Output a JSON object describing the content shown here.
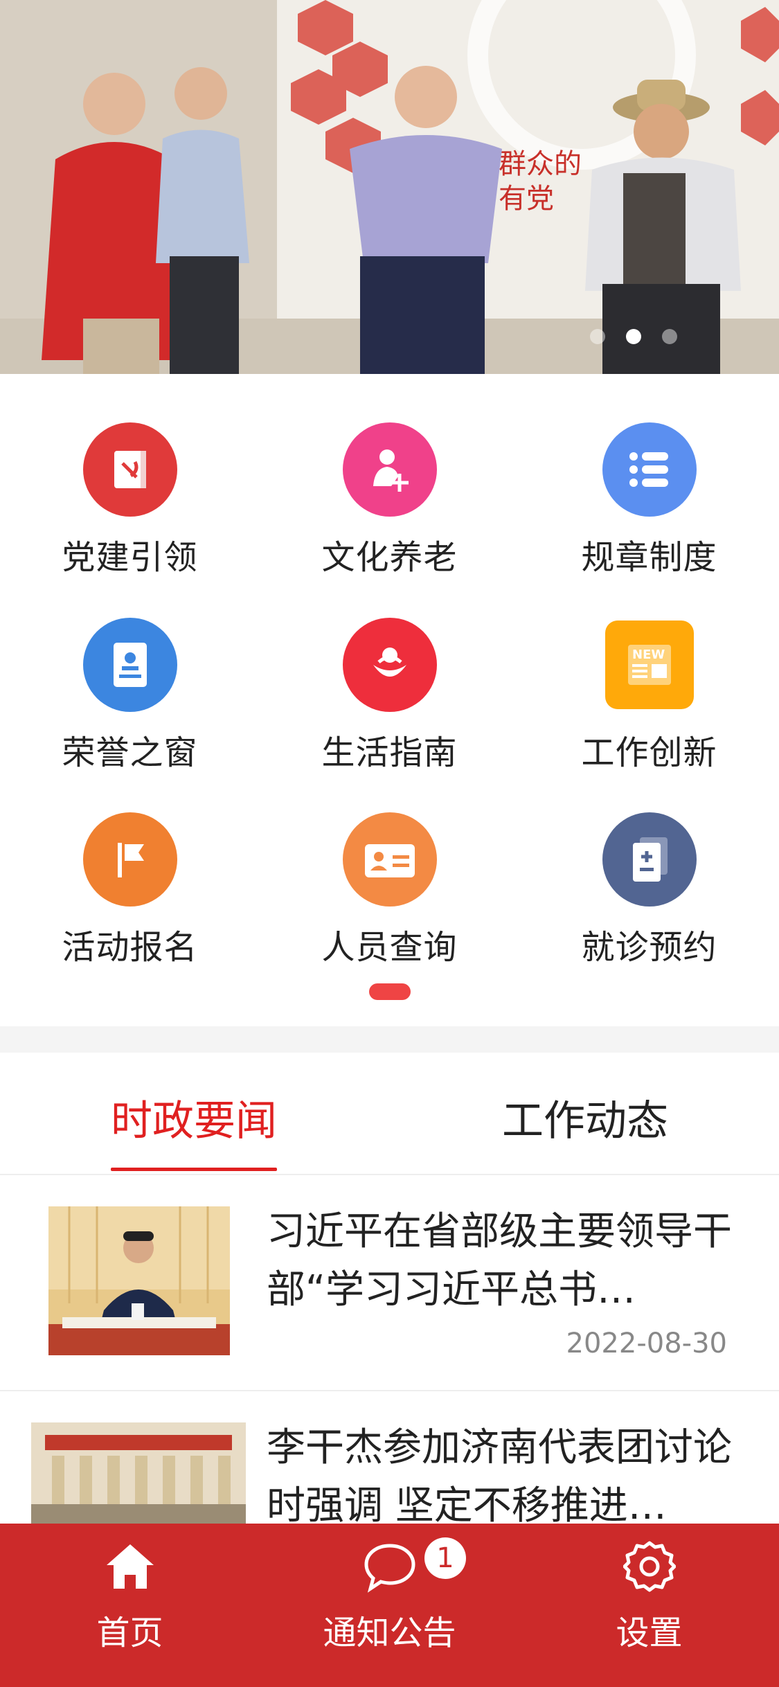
{
  "banner": {
    "slides": 3,
    "active_slide": 2
  },
  "grid": {
    "items": [
      {
        "label": "党建引领",
        "icon": "party-book-icon",
        "color": "#e03a3a"
      },
      {
        "label": "文化养老",
        "icon": "elder-care-icon",
        "color": "#f0418a"
      },
      {
        "label": "规章制度",
        "icon": "list-icon",
        "color": "#5b8ff0"
      },
      {
        "label": "荣誉之窗",
        "icon": "certificate-icon",
        "color": "#3c86e0"
      },
      {
        "label": "生活指南",
        "icon": "life-guide-icon",
        "color": "#ee2e3c"
      },
      {
        "label": "工作创新",
        "icon": "news-icon",
        "color": "#ffa90a"
      },
      {
        "label": "活动报名",
        "icon": "flag-icon",
        "color": "#f08030"
      },
      {
        "label": "人员查询",
        "icon": "id-card-icon",
        "color": "#f38a44"
      },
      {
        "label": "就诊预约",
        "icon": "medical-record-icon",
        "color": "#526592"
      }
    ]
  },
  "tabs": [
    {
      "label": "时政要闻",
      "active": true
    },
    {
      "label": "工作动态",
      "active": false
    }
  ],
  "news": [
    {
      "title": "习近平在省部级主要领导干部“学习习近平总书…",
      "date": "2022-08-30"
    },
    {
      "title": "李干杰参加济南代表团讨论时强调 坚定不移推进…",
      "date": ""
    }
  ],
  "bottom_nav": {
    "items": [
      {
        "label": "首页",
        "icon": "home-icon"
      },
      {
        "label": "通知公告",
        "icon": "message-icon",
        "badge": "1"
      },
      {
        "label": "设置",
        "icon": "gear-icon"
      }
    ]
  },
  "colors": {
    "accent": "#e02020",
    "nav_bg": "#cc2a2a"
  }
}
